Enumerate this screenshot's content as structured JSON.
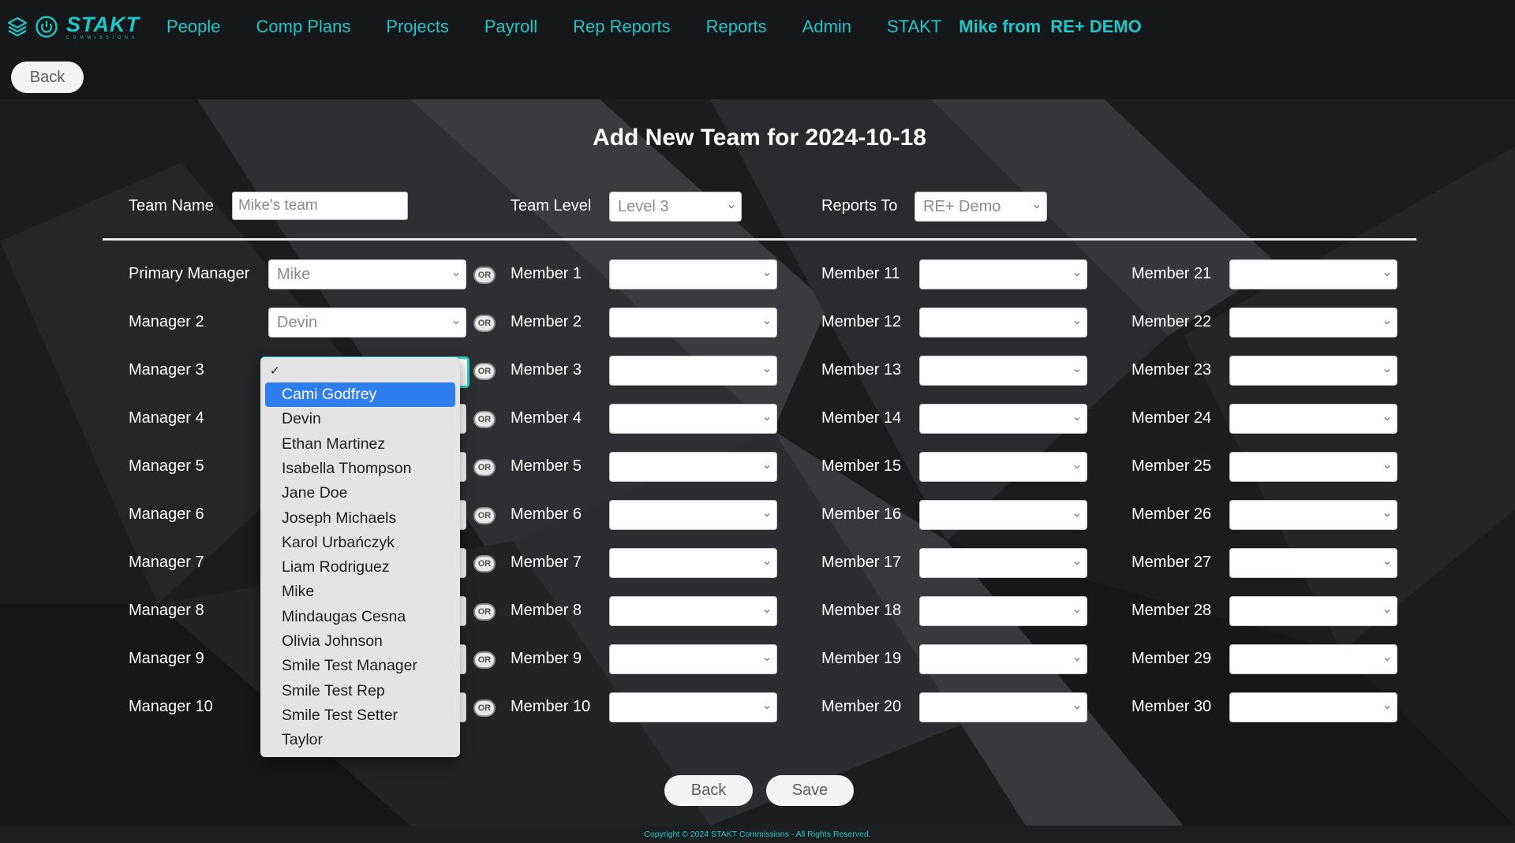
{
  "brand": {
    "name": "STAKT",
    "tagline": "COMMISSIONS"
  },
  "nav": {
    "items": [
      "People",
      "Comp Plans",
      "Projects",
      "Payroll",
      "Rep Reports",
      "Reports",
      "Admin",
      "STAKT"
    ],
    "user_from": "Mike from",
    "org": "RE+ DEMO"
  },
  "top_back_label": "Back",
  "title": "Add New Team for 2024-10-18",
  "fields": {
    "team_name_label": "Team Name",
    "team_name_value": "Mike's team",
    "team_level_label": "Team Level",
    "team_level_value": "Level 3",
    "reports_to_label": "Reports To",
    "reports_to_value": "RE+ Demo"
  },
  "managers": [
    {
      "label": "Primary Manager",
      "value": "Mike"
    },
    {
      "label": "Manager 2",
      "value": "Devin"
    },
    {
      "label": "Manager 3",
      "value": ""
    },
    {
      "label": "Manager 4",
      "value": ""
    },
    {
      "label": "Manager 5",
      "value": ""
    },
    {
      "label": "Manager 6",
      "value": ""
    },
    {
      "label": "Manager 7",
      "value": ""
    },
    {
      "label": "Manager 8",
      "value": ""
    },
    {
      "label": "Manager 9",
      "value": ""
    },
    {
      "label": "Manager 10",
      "value": ""
    }
  ],
  "or_label": "OR",
  "members": [
    "Member 1",
    "Member 2",
    "Member 3",
    "Member 4",
    "Member 5",
    "Member 6",
    "Member 7",
    "Member 8",
    "Member 9",
    "Member 10",
    "Member 11",
    "Member 12",
    "Member 13",
    "Member 14",
    "Member 15",
    "Member 16",
    "Member 17",
    "Member 18",
    "Member 19",
    "Member 20",
    "Member 21",
    "Member 22",
    "Member 23",
    "Member 24",
    "Member 25",
    "Member 26",
    "Member 27",
    "Member 28",
    "Member 29",
    "Member 30"
  ],
  "dropdown": {
    "check": "✓",
    "highlighted": "Cami Godfrey",
    "options": [
      "Cami Godfrey",
      "Devin",
      "Ethan Martinez",
      "Isabella Thompson",
      "Jane Doe",
      "Joseph Michaels",
      "Karol Urbańczyk",
      "Liam Rodriguez",
      "Mike",
      "Mindaugas Cesna",
      "Olivia Johnson",
      "Smile Test Manager",
      "Smile Test Rep",
      "Smile Test Setter",
      "Taylor"
    ]
  },
  "buttons": {
    "back": "Back",
    "save": "Save"
  },
  "footer": "Copyright © 2024 STAKT Commissions - All Rights Reserved.",
  "colors": {
    "accent": "#21c6c9",
    "highlight": "#2f7ef0",
    "focus_ring": "#27d1cc"
  }
}
